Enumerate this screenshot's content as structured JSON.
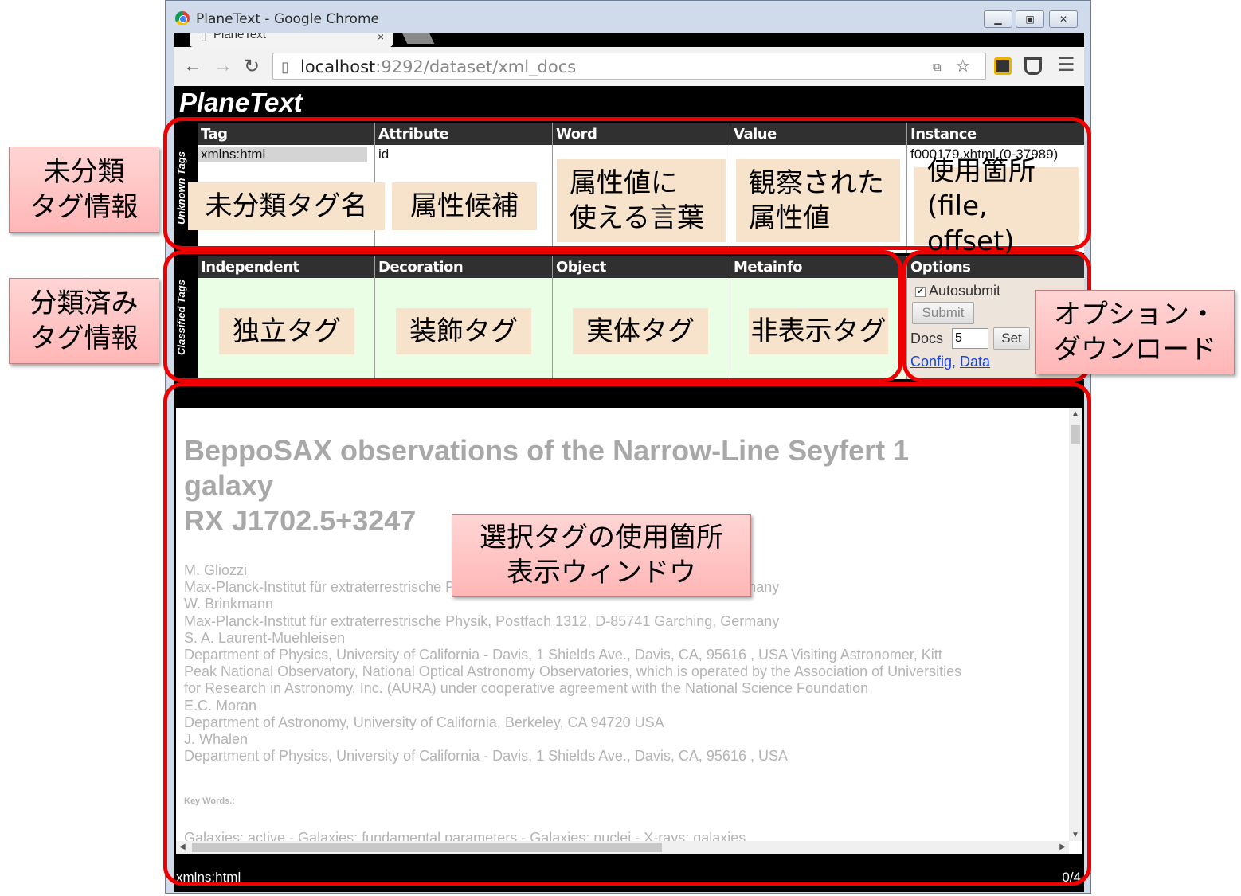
{
  "window": {
    "title": "PlaneText - Google Chrome",
    "controls": [
      "minimize",
      "maximize",
      "close"
    ]
  },
  "tab": {
    "label": "PlaneText",
    "close": "×"
  },
  "address": {
    "host": "localhost",
    "path": ":9292/dataset/xml_docs"
  },
  "app": {
    "logo": "PlaneText"
  },
  "sections": {
    "unknown": "Unknown Tags",
    "classified": "Classified Tags"
  },
  "unknown_panels": {
    "tag": {
      "header": "Tag",
      "selected": "xmlns:html"
    },
    "attribute": {
      "header": "Attribute",
      "first": "id"
    },
    "word": {
      "header": "Word"
    },
    "value": {
      "header": "Value"
    },
    "instance": {
      "header": "Instance",
      "first": "f000179.xhtml (0-37989)"
    }
  },
  "classified_panels": {
    "independent": "Independent",
    "decoration": "Decoration",
    "object": "Object",
    "metainfo": "Metainfo"
  },
  "options": {
    "header": "Options",
    "autosubmit_label": "Autosubmit",
    "autosubmit_checked": true,
    "submit_label": "Submit",
    "docs_label": "Docs",
    "docs_value": "5",
    "set_label": "Set",
    "config_link": "Config",
    "data_link": "Data",
    "separator": ", "
  },
  "document": {
    "title_lines": [
      "BeppoSAX observations of the Narrow-Line Seyfert 1",
      "galaxy",
      "RX J1702.5+3247"
    ],
    "lines": [
      "M. Gliozzi",
      "Max-Planck-Institut für extraterrestrische Physik, Postfach 1312, D-85741 Garching, Germany",
      "W. Brinkmann",
      "Max-Planck-Institut für extraterrestrische Physik, Postfach 1312, D-85741 Garching, Germany",
      "S. A. Laurent-Muehleisen",
      "Department of Physics, University of California - Davis, 1 Shields Ave., Davis, CA, 95616 , USA Visiting Astronomer, Kitt",
      "Peak National Observatory, National Optical Astronomy Observatories, which is operated by the Association of Universities",
      "for Research in Astronomy, Inc. (AURA) under cooperative agreement with the National Science Foundation",
      "E.C. Moran",
      "Department of Astronomy, University of California, Berkeley, CA 94720 USA",
      "J. Whalen",
      "Department of Physics, University of California - Davis, 1 Shields Ave., Davis, CA, 95616 , USA"
    ],
    "keywords_label": "Key Words.:",
    "keywords": "Galaxies: active -  Galaxies: fundamental parameters -  Galaxies: nuclei -  X-rays: galaxies"
  },
  "status": {
    "tag": "xmlns:html",
    "count": "0/4"
  },
  "annotations": {
    "unknown_info": "未分類\nタグ情報",
    "classified_info": "分類済み\nタグ情報",
    "options_download": "オプション・\nダウンロード",
    "unknown_tag_name": "未分類タグ名",
    "attribute_candidates": "属性候補",
    "words_for_values": "属性値に\n使える言葉",
    "observed_values": "観察された\n属性値",
    "usage_location": "使用箇所\n(file, offset)",
    "independent_tag": "独立タグ",
    "decoration_tag": "装飾タグ",
    "object_tag": "実体タグ",
    "hidden_tag": "非表示タグ",
    "selected_tag_window": "選択タグの使用箇所\n表示ウィンドウ"
  },
  "colors": {
    "annotation_red": "#ee0000",
    "unknown_panel_bg": "#ffffff",
    "classified_panel_bg": "#eafde5",
    "options_bg": "#ede4db",
    "header_bg": "#303030"
  }
}
